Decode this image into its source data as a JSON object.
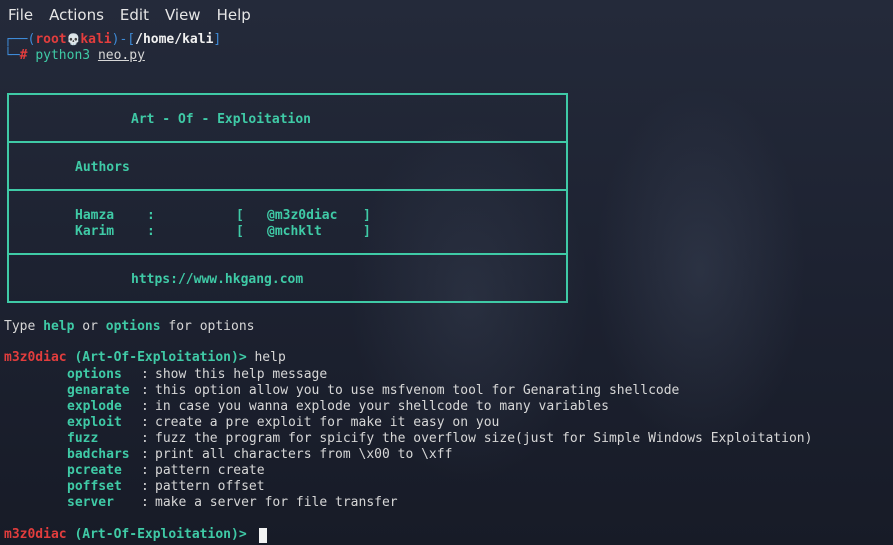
{
  "menu": {
    "file": "File",
    "actions": "Actions",
    "edit": "Edit",
    "view": "View",
    "help": "Help"
  },
  "prompt": {
    "open": "┌──(",
    "user": "root",
    "skull": "💀",
    "host": "kali",
    "mid": ")-[",
    "path": "/home/kali",
    "close": "]",
    "corner": "└─",
    "hash": "#",
    "command": "python3",
    "file": "neo.py"
  },
  "banner": {
    "title": "Art - Of - Exploitation",
    "authors_label": "Authors",
    "authors": [
      {
        "name": "Hamza",
        "colon": ":",
        "open": "[",
        "handle": "@m3z0diac",
        "close": "]"
      },
      {
        "name": "Karim",
        "colon": ":",
        "open": "[",
        "handle": "@mchklt",
        "close": "]"
      }
    ],
    "url": "https://www.hkgang.com"
  },
  "hint": {
    "type": "Type",
    "help": "help",
    "or": "or",
    "options": "options",
    "suffix": "for options"
  },
  "shell": {
    "user": "m3z0diac",
    "context": "(Art-Of-Exploitation)>",
    "entered": "help"
  },
  "help_rows": [
    {
      "option": "options",
      "desc": "show this help message"
    },
    {
      "option": "genarate",
      "desc": "this option allow you to use msfvenom tool for Genarating shellcode"
    },
    {
      "option": "explode",
      "desc": "in case you wanna explode your shellcode to many variables"
    },
    {
      "option": "exploit",
      "desc": "create a pre exploit for make it easy on you"
    },
    {
      "option": "fuzz",
      "desc": "fuzz the program for spicify the overflow size(just for Simple Windows Exploitation)"
    },
    {
      "option": "badchars",
      "desc": "print all characters from \\x00 to \\xff"
    },
    {
      "option": "pcreate",
      "desc": "pattern create"
    },
    {
      "option": "poffset",
      "desc": "pattern offset"
    },
    {
      "option": "server",
      "desc": "make a server for file transfer"
    }
  ],
  "colors": {
    "teal": "#3fcaa6",
    "blue": "#3e8ad6",
    "red": "#e23d3d",
    "background": "#1c2130"
  }
}
